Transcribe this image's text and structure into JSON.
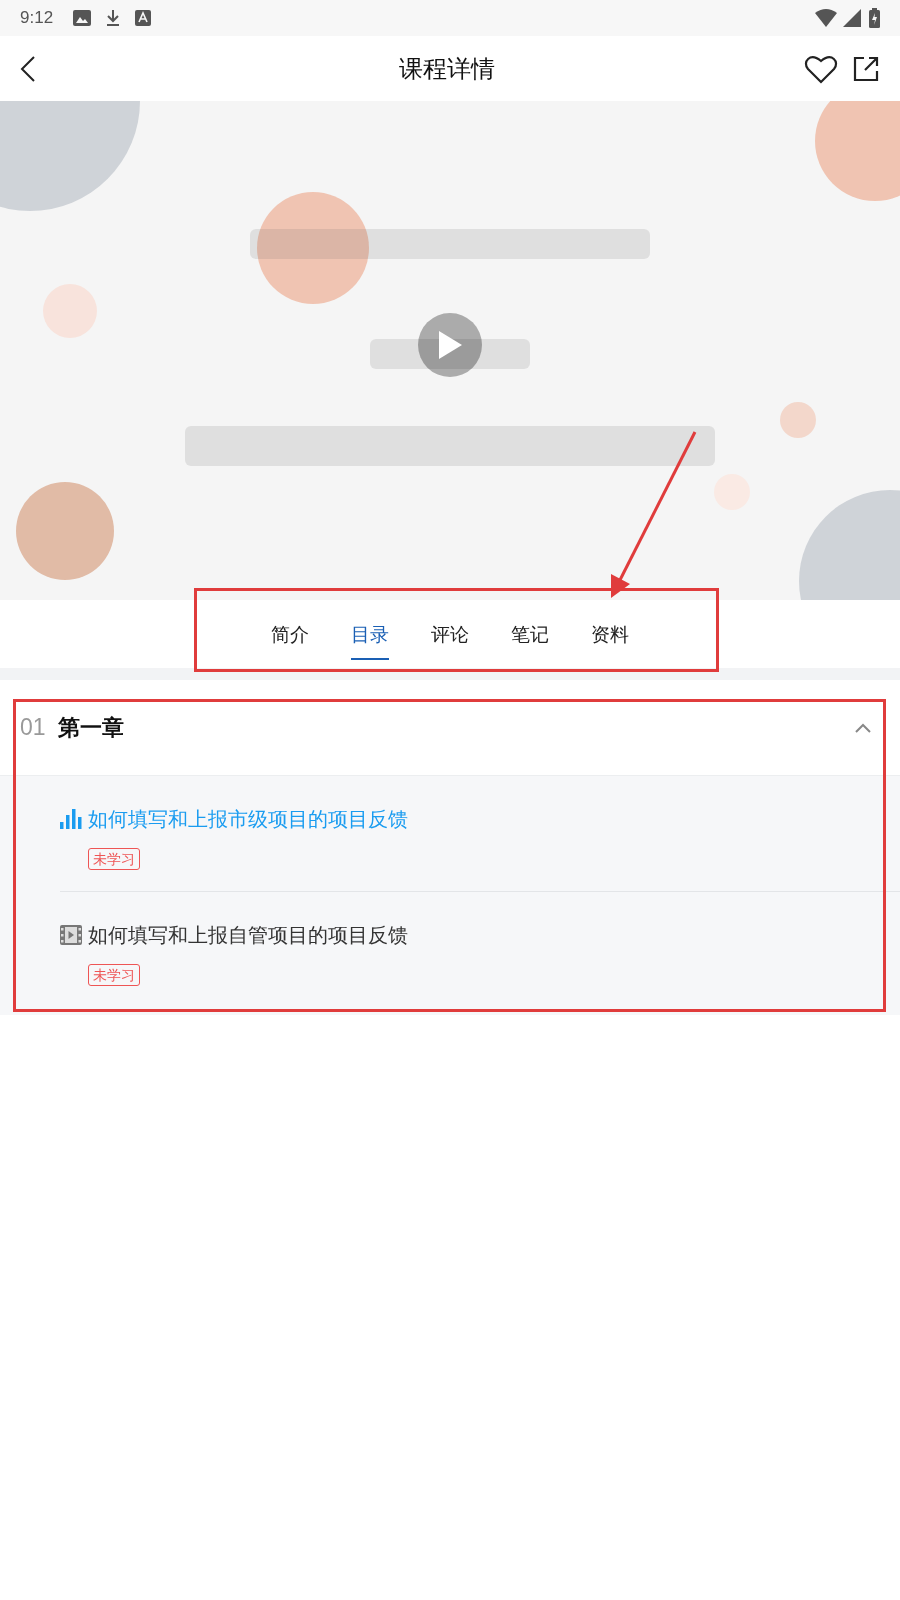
{
  "status_bar": {
    "time": "9:12"
  },
  "header": {
    "title": "课程详情"
  },
  "tabs": [
    {
      "label": "简介",
      "selected": false
    },
    {
      "label": "目录",
      "selected": true
    },
    {
      "label": "评论",
      "selected": false
    },
    {
      "label": "笔记",
      "selected": false
    },
    {
      "label": "资料",
      "selected": false
    }
  ],
  "chapters": [
    {
      "number": "01",
      "title": "第一章",
      "expanded": true,
      "lessons": [
        {
          "title": "如何填写和上报市级项目的项目反馈",
          "selected": true,
          "tag": "未学习"
        },
        {
          "title": "如何填写和上报自管项目的项目反馈",
          "selected": false,
          "tag": "未学习"
        }
      ]
    }
  ]
}
